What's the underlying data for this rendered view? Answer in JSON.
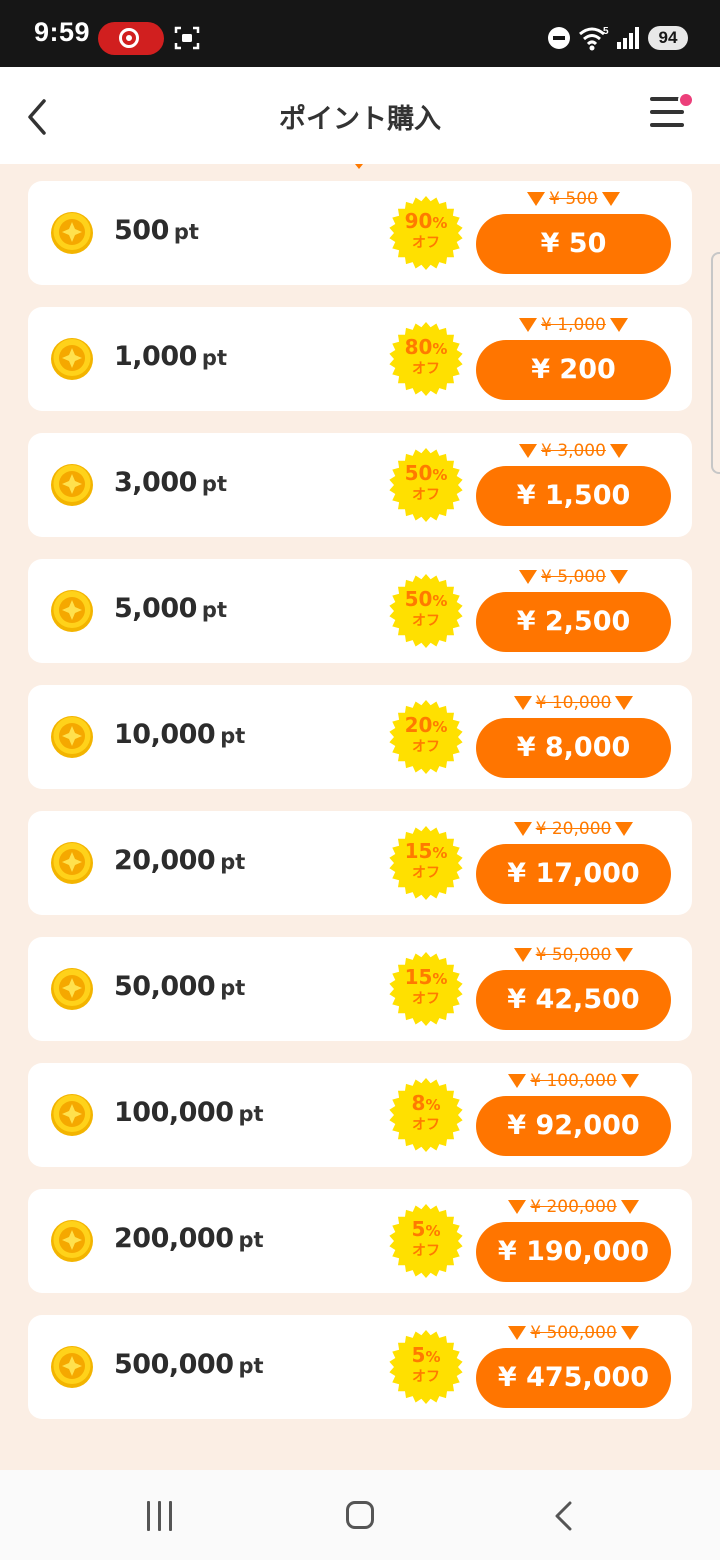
{
  "status_bar": {
    "time": "9:59",
    "battery": "94"
  },
  "header": {
    "title": "ポイント購入"
  },
  "colors": {
    "accent": "#ff7500",
    "badge_yellow": "#ffe000",
    "background": "#fbeee4"
  },
  "plans": [
    {
      "points": "500",
      "unit": "pt",
      "discount": "90",
      "percent_sign": "%",
      "off_label": "オフ",
      "original_price": "¥ 500",
      "price": "¥ 50"
    },
    {
      "points": "1,000",
      "unit": "pt",
      "discount": "80",
      "percent_sign": "%",
      "off_label": "オフ",
      "original_price": "¥ 1,000",
      "price": "¥ 200"
    },
    {
      "points": "3,000",
      "unit": "pt",
      "discount": "50",
      "percent_sign": "%",
      "off_label": "オフ",
      "original_price": "¥ 3,000",
      "price": "¥ 1,500"
    },
    {
      "points": "5,000",
      "unit": "pt",
      "discount": "50",
      "percent_sign": "%",
      "off_label": "オフ",
      "original_price": "¥ 5,000",
      "price": "¥ 2,500"
    },
    {
      "points": "10,000",
      "unit": "pt",
      "discount": "20",
      "percent_sign": "%",
      "off_label": "オフ",
      "original_price": "¥ 10,000",
      "price": "¥ 8,000"
    },
    {
      "points": "20,000",
      "unit": "pt",
      "discount": "15",
      "percent_sign": "%",
      "off_label": "オフ",
      "original_price": "¥ 20,000",
      "price": "¥ 17,000"
    },
    {
      "points": "50,000",
      "unit": "pt",
      "discount": "15",
      "percent_sign": "%",
      "off_label": "オフ",
      "original_price": "¥ 50,000",
      "price": "¥ 42,500"
    },
    {
      "points": "100,000",
      "unit": "pt",
      "discount": "8",
      "percent_sign": "%",
      "off_label": "オフ",
      "original_price": "¥ 100,000",
      "price": "¥ 92,000"
    },
    {
      "points": "200,000",
      "unit": "pt",
      "discount": "5",
      "percent_sign": "%",
      "off_label": "オフ",
      "original_price": "¥ 200,000",
      "price": "¥ 190,000"
    },
    {
      "points": "500,000",
      "unit": "pt",
      "discount": "5",
      "percent_sign": "%",
      "off_label": "オフ",
      "original_price": "¥ 500,000",
      "price": "¥ 475,000"
    }
  ]
}
